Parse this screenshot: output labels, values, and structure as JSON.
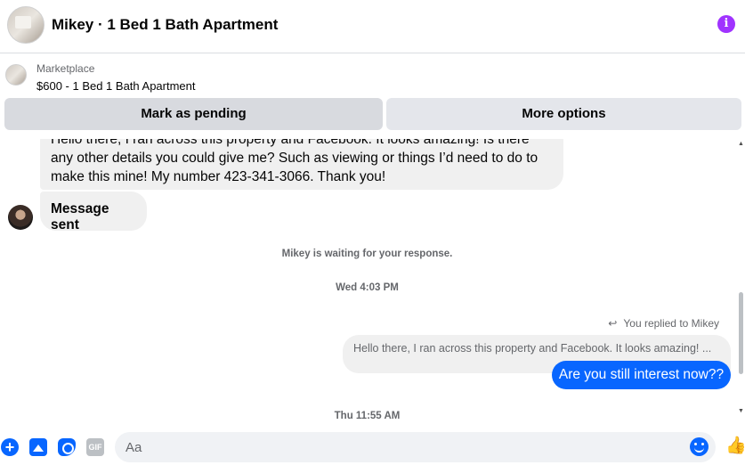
{
  "header": {
    "title": "Mikey · 1 Bed 1 Bath Apartment",
    "info_icon": "info-icon",
    "accent_color": "#a033ff"
  },
  "listing": {
    "source": "Marketplace",
    "item": "$600 - 1 Bed 1 Bath Apartment"
  },
  "actions": {
    "mark_pending": "Mark as pending",
    "more_options": "More options"
  },
  "messages": {
    "incoming_long": "Hello there, I ran across this property and Facebook. It looks amazing! Is there any other details you could give me? Such as viewing or things I’d need to do to make this mine!  My number 423-341-3066. Thank you!",
    "incoming_short": "Message sent",
    "waiting_status": "Mikey is waiting for your response.",
    "timestamp_1": "Wed 4:03 PM",
    "replied_label": "You replied to Mikey",
    "quoted_text": "Hello there, I ran across this property and Facebook. It looks amazing! ...",
    "outgoing": "Are you still interest now??",
    "timestamp_2": "Thu 11:55 AM"
  },
  "composer": {
    "placeholder": "Aa",
    "gif_label": "GIF",
    "plus_glyph": "+",
    "like_glyph": "👍",
    "reply_glyph": "↩",
    "accent_color": "#0866ff"
  }
}
